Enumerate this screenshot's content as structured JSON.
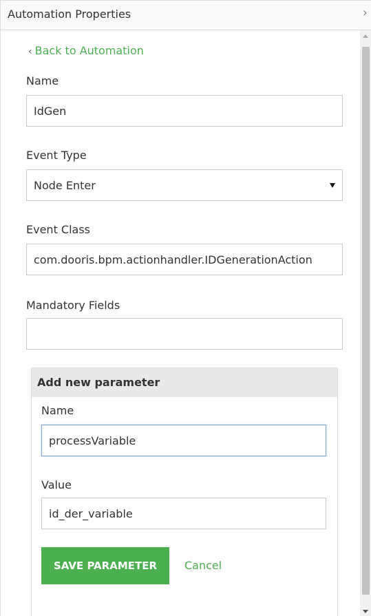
{
  "header": {
    "title": "Automation Properties",
    "collapse_icon": "chevron-right-icon"
  },
  "back_link": {
    "icon": "chevron-left-icon",
    "label": "Back to Automation"
  },
  "form": {
    "name": {
      "label": "Name",
      "value": "IdGen"
    },
    "event_type": {
      "label": "Event Type",
      "value": "Node Enter"
    },
    "event_class": {
      "label": "Event Class",
      "value": "com.dooris.bpm.actionhandler.IDGenerationAction"
    },
    "mandatory_fields": {
      "label": "Mandatory Fields",
      "value": ""
    }
  },
  "parameter": {
    "title": "Add new parameter",
    "name": {
      "label": "Name",
      "value": "processVariable"
    },
    "value": {
      "label": "Value",
      "value": "id_der_variable"
    },
    "save_label": "SAVE PARAMETER",
    "cancel_label": "Cancel"
  },
  "colors": {
    "accent": "#4caf50",
    "focus_border": "#7aa7d6",
    "section_header": "#e9e9e9"
  }
}
